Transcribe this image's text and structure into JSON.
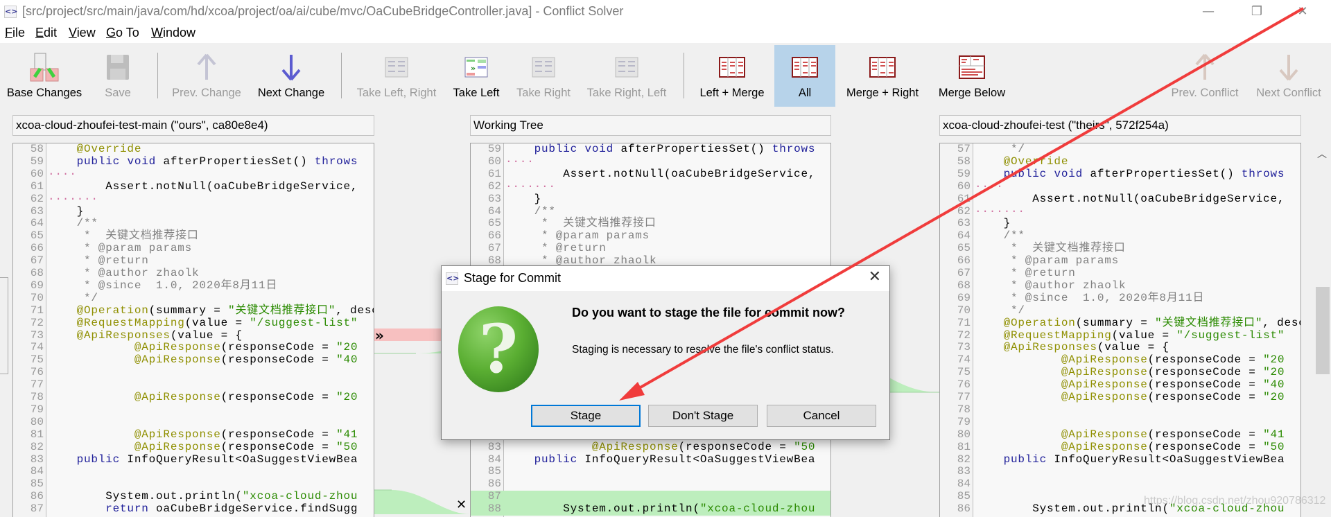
{
  "window": {
    "title": "[src/project/src/main/java/com/hd/xcoa/project/oa/ai/cube/mvc/OaCubeBridgeController.java] - Conflict Solver",
    "app_icon": "diff-brackets-icon"
  },
  "menu": [
    {
      "label": "File",
      "key": "F"
    },
    {
      "label": "Edit",
      "key": "E"
    },
    {
      "label": "View",
      "key": "V"
    },
    {
      "label": "Go To",
      "key": "G"
    },
    {
      "label": "Window",
      "key": "W"
    }
  ],
  "toolbar": [
    {
      "id": "base-changes",
      "label": "Base Changes",
      "enabled": true,
      "icon": "base-changes-icon"
    },
    {
      "id": "save",
      "label": "Save",
      "enabled": false,
      "icon": "floppy-disk-icon"
    },
    {
      "id": "prev-change",
      "label": "Prev. Change",
      "enabled": false,
      "icon": "arrow-up-icon"
    },
    {
      "id": "next-change",
      "label": "Next Change",
      "enabled": true,
      "icon": "arrow-down-icon"
    },
    {
      "id": "take-left-right",
      "label": "Take Left, Right",
      "enabled": false,
      "icon": "take-left-right-icon"
    },
    {
      "id": "take-left",
      "label": "Take Left",
      "enabled": true,
      "icon": "take-left-icon"
    },
    {
      "id": "take-right",
      "label": "Take Right",
      "enabled": false,
      "icon": "take-right-icon"
    },
    {
      "id": "take-right-left",
      "label": "Take Right, Left",
      "enabled": false,
      "icon": "take-right-left-icon"
    },
    {
      "id": "left-merge",
      "label": "Left + Merge",
      "enabled": true,
      "icon": "left-merge-layout-icon"
    },
    {
      "id": "all",
      "label": "All",
      "enabled": true,
      "selected": true,
      "icon": "all-panes-layout-icon"
    },
    {
      "id": "merge-right",
      "label": "Merge + Right",
      "enabled": true,
      "icon": "merge-right-layout-icon"
    },
    {
      "id": "merge-below",
      "label": "Merge Below",
      "enabled": true,
      "icon": "merge-below-layout-icon"
    },
    {
      "id": "prev-conflict",
      "label": "Prev. Conflict",
      "enabled": false,
      "icon": "arrow-up-icon"
    },
    {
      "id": "next-conflict",
      "label": "Next Conflict",
      "enabled": false,
      "icon": "arrow-down-icon"
    }
  ],
  "panes": {
    "left": {
      "header": "xcoa-cloud-zhoufei-test-main (\"ours\", ca80e8e4)",
      "start": 58,
      "lines": [
        "    @Override",
        "    public void afterPropertiesSet() throws",
        "····",
        "        Assert.notNull(oaCubeBridgeService,",
        "·······",
        "    }",
        "    /**",
        "     *  关键文档推荐接口",
        "     * @param params",
        "     * @return",
        "     * @author zhaolk",
        "     * @since  1.0, 2020年8月11日",
        "     */",
        "    @Operation(summary = \"关键文档推荐接口\", desc",
        "    @RequestMapping(value = \"/suggest-list\"",
        "    @ApiResponses(value = {",
        "            @ApiResponse(responseCode = \"20",
        "            @ApiResponse(responseCode = \"40",
        "",
        "",
        "            @ApiResponse(responseCode = \"20",
        "",
        "",
        "            @ApiResponse(responseCode = \"41",
        "            @ApiResponse(responseCode = \"50",
        "    public InfoQueryResult<OaSuggestViewBea",
        "",
        "",
        "        System.out.println(\"xcoa-cloud-zhou",
        "        return oaCubeBridgeService.findSugg"
      ]
    },
    "middle": {
      "header": "Working Tree",
      "start": 59,
      "green_from": 87,
      "lines": [
        "    public void afterPropertiesSet() throws",
        "····",
        "        Assert.notNull(oaCubeBridgeService,",
        "·······",
        "    }",
        "    /**",
        "     *  关键文档推荐接口",
        "     * @param params",
        "     * @return",
        "     * @author zhaolk",
        "",
        "",
        "",
        "",
        "",
        "",
        "",
        "",
        "",
        "",
        "",
        "",
        "",
        "",
        "            @ApiResponse(responseCode = \"50",
        "    public InfoQueryResult<OaSuggestViewBea",
        "",
        "",
        "",
        "        System.out.println(\"xcoa-cloud-zhou"
      ]
    },
    "right": {
      "header": "xcoa-cloud-zhoufei-test (\"theirs\", 572f254a)",
      "start": 57,
      "lines": [
        "     */",
        "    @Override",
        "    public void afterPropertiesSet() throws",
        "····",
        "        Assert.notNull(oaCubeBridgeService,",
        "·······",
        "    }",
        "    /**",
        "     *  关键文档推荐接口",
        "     * @param params",
        "     * @return",
        "     * @author zhaolk",
        "     * @since  1.0, 2020年8月11日",
        "     */",
        "    @Operation(summary = \"关键文档推荐接口\", desc",
        "    @RequestMapping(value = \"/suggest-list\"",
        "    @ApiResponses(value = {",
        "            @ApiResponse(responseCode = \"20",
        "            @ApiResponse(responseCode = \"20",
        "            @ApiResponse(responseCode = \"40",
        "            @ApiResponse(responseCode = \"20",
        "",
        "",
        "            @ApiResponse(responseCode = \"41",
        "            @ApiResponse(responseCode = \"50",
        "    public InfoQueryResult<OaSuggestViewBea",
        "",
        "",
        "",
        "        System.out.println(\"xcoa-cloud-zhou"
      ]
    }
  },
  "markers": {
    "take_left": "»",
    "discard": "✕"
  },
  "dialog": {
    "title": "Stage for Commit",
    "heading": "Do you want to stage the file for commit now?",
    "message": "Staging is necessary to resolve the file's conflict status.",
    "buttons": [
      "Stage",
      "Don't Stage",
      "Cancel"
    ],
    "default": "Stage",
    "icon": "question-icon"
  },
  "watermark": "https://blog.csdn.net/zhou920786312",
  "colors": {
    "annotation": "#8f8f00",
    "keyword": "#20209a",
    "string": "#2a8a00",
    "comment": "#808080",
    "conflict": "#f7c0c0",
    "addition": "#bdeebd",
    "selected": "#b7d3ea",
    "arrow": "#f03c3c"
  }
}
